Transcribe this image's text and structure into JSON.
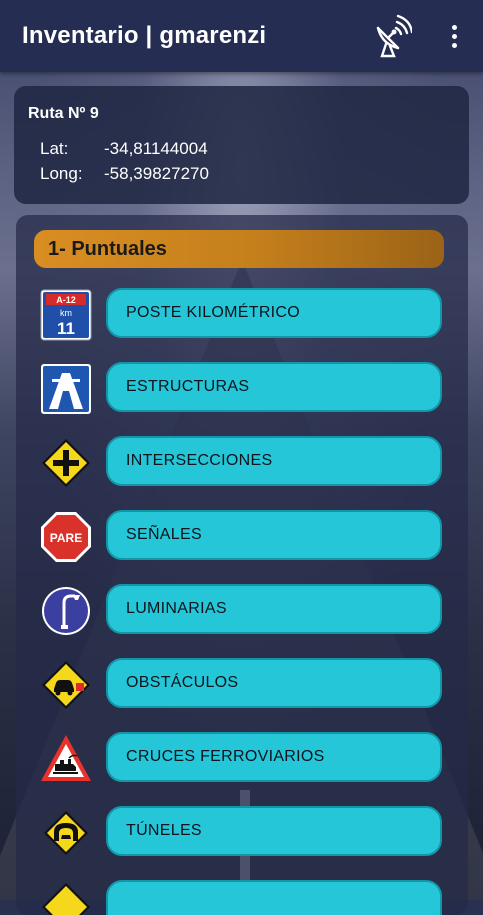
{
  "appbar": {
    "title": "Inventario | gmarenzi",
    "icons": [
      "satellite-dish-icon",
      "more-vert-icon"
    ]
  },
  "location": {
    "route": "Ruta Nº 9",
    "lat_label": "Lat:",
    "lat_value": "-34,81144004",
    "long_label": "Long:",
    "long_value": "-58,39827270"
  },
  "section": {
    "title": "1- Puntuales"
  },
  "items": [
    {
      "label": "POSTE KILOMÉTRICO",
      "icon": "km-post-sign-icon",
      "sign_route": "A-12",
      "sign_km": "km",
      "sign_num": "11"
    },
    {
      "label": "ESTRUCTURAS",
      "icon": "highway-sign-icon"
    },
    {
      "label": "INTERSECCIONES",
      "icon": "intersection-sign-icon"
    },
    {
      "label": "SEÑALES",
      "icon": "stop-sign-icon",
      "sign_text": "PARE"
    },
    {
      "label": "LUMINARIAS",
      "icon": "street-light-icon"
    },
    {
      "label": "OBSTÁCULOS",
      "icon": "obstacle-sign-icon"
    },
    {
      "label": "CRUCES FERROVIARIOS",
      "icon": "railway-crossing-sign-icon"
    },
    {
      "label": "TÚNELES",
      "icon": "tunnel-sign-icon"
    },
    {
      "label": "",
      "icon": "warning-sign-icon"
    }
  ],
  "colors": {
    "appbar": "#252d52",
    "button": "#25c6d8",
    "section_header": "#d98e22"
  }
}
